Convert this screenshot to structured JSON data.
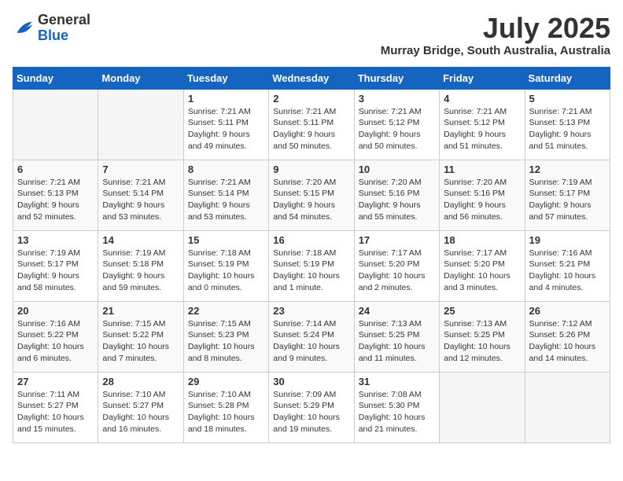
{
  "header": {
    "logo_line1": "General",
    "logo_line2": "Blue",
    "month_year": "July 2025",
    "location": "Murray Bridge, South Australia, Australia"
  },
  "weekdays": [
    "Sunday",
    "Monday",
    "Tuesday",
    "Wednesday",
    "Thursday",
    "Friday",
    "Saturday"
  ],
  "weeks": [
    [
      {
        "day": "",
        "empty": true
      },
      {
        "day": "",
        "empty": true
      },
      {
        "day": "1",
        "sunrise": "Sunrise: 7:21 AM",
        "sunset": "Sunset: 5:11 PM",
        "daylight": "Daylight: 9 hours and 49 minutes."
      },
      {
        "day": "2",
        "sunrise": "Sunrise: 7:21 AM",
        "sunset": "Sunset: 5:11 PM",
        "daylight": "Daylight: 9 hours and 50 minutes."
      },
      {
        "day": "3",
        "sunrise": "Sunrise: 7:21 AM",
        "sunset": "Sunset: 5:12 PM",
        "daylight": "Daylight: 9 hours and 50 minutes."
      },
      {
        "day": "4",
        "sunrise": "Sunrise: 7:21 AM",
        "sunset": "Sunset: 5:12 PM",
        "daylight": "Daylight: 9 hours and 51 minutes."
      },
      {
        "day": "5",
        "sunrise": "Sunrise: 7:21 AM",
        "sunset": "Sunset: 5:13 PM",
        "daylight": "Daylight: 9 hours and 51 minutes."
      }
    ],
    [
      {
        "day": "6",
        "sunrise": "Sunrise: 7:21 AM",
        "sunset": "Sunset: 5:13 PM",
        "daylight": "Daylight: 9 hours and 52 minutes."
      },
      {
        "day": "7",
        "sunrise": "Sunrise: 7:21 AM",
        "sunset": "Sunset: 5:14 PM",
        "daylight": "Daylight: 9 hours and 53 minutes."
      },
      {
        "day": "8",
        "sunrise": "Sunrise: 7:21 AM",
        "sunset": "Sunset: 5:14 PM",
        "daylight": "Daylight: 9 hours and 53 minutes."
      },
      {
        "day": "9",
        "sunrise": "Sunrise: 7:20 AM",
        "sunset": "Sunset: 5:15 PM",
        "daylight": "Daylight: 9 hours and 54 minutes."
      },
      {
        "day": "10",
        "sunrise": "Sunrise: 7:20 AM",
        "sunset": "Sunset: 5:16 PM",
        "daylight": "Daylight: 9 hours and 55 minutes."
      },
      {
        "day": "11",
        "sunrise": "Sunrise: 7:20 AM",
        "sunset": "Sunset: 5:16 PM",
        "daylight": "Daylight: 9 hours and 56 minutes."
      },
      {
        "day": "12",
        "sunrise": "Sunrise: 7:19 AM",
        "sunset": "Sunset: 5:17 PM",
        "daylight": "Daylight: 9 hours and 57 minutes."
      }
    ],
    [
      {
        "day": "13",
        "sunrise": "Sunrise: 7:19 AM",
        "sunset": "Sunset: 5:17 PM",
        "daylight": "Daylight: 9 hours and 58 minutes."
      },
      {
        "day": "14",
        "sunrise": "Sunrise: 7:19 AM",
        "sunset": "Sunset: 5:18 PM",
        "daylight": "Daylight: 9 hours and 59 minutes."
      },
      {
        "day": "15",
        "sunrise": "Sunrise: 7:18 AM",
        "sunset": "Sunset: 5:19 PM",
        "daylight": "Daylight: 10 hours and 0 minutes."
      },
      {
        "day": "16",
        "sunrise": "Sunrise: 7:18 AM",
        "sunset": "Sunset: 5:19 PM",
        "daylight": "Daylight: 10 hours and 1 minute."
      },
      {
        "day": "17",
        "sunrise": "Sunrise: 7:17 AM",
        "sunset": "Sunset: 5:20 PM",
        "daylight": "Daylight: 10 hours and 2 minutes."
      },
      {
        "day": "18",
        "sunrise": "Sunrise: 7:17 AM",
        "sunset": "Sunset: 5:20 PM",
        "daylight": "Daylight: 10 hours and 3 minutes."
      },
      {
        "day": "19",
        "sunrise": "Sunrise: 7:16 AM",
        "sunset": "Sunset: 5:21 PM",
        "daylight": "Daylight: 10 hours and 4 minutes."
      }
    ],
    [
      {
        "day": "20",
        "sunrise": "Sunrise: 7:16 AM",
        "sunset": "Sunset: 5:22 PM",
        "daylight": "Daylight: 10 hours and 6 minutes."
      },
      {
        "day": "21",
        "sunrise": "Sunrise: 7:15 AM",
        "sunset": "Sunset: 5:22 PM",
        "daylight": "Daylight: 10 hours and 7 minutes."
      },
      {
        "day": "22",
        "sunrise": "Sunrise: 7:15 AM",
        "sunset": "Sunset: 5:23 PM",
        "daylight": "Daylight: 10 hours and 8 minutes."
      },
      {
        "day": "23",
        "sunrise": "Sunrise: 7:14 AM",
        "sunset": "Sunset: 5:24 PM",
        "daylight": "Daylight: 10 hours and 9 minutes."
      },
      {
        "day": "24",
        "sunrise": "Sunrise: 7:13 AM",
        "sunset": "Sunset: 5:25 PM",
        "daylight": "Daylight: 10 hours and 11 minutes."
      },
      {
        "day": "25",
        "sunrise": "Sunrise: 7:13 AM",
        "sunset": "Sunset: 5:25 PM",
        "daylight": "Daylight: 10 hours and 12 minutes."
      },
      {
        "day": "26",
        "sunrise": "Sunrise: 7:12 AM",
        "sunset": "Sunset: 5:26 PM",
        "daylight": "Daylight: 10 hours and 14 minutes."
      }
    ],
    [
      {
        "day": "27",
        "sunrise": "Sunrise: 7:11 AM",
        "sunset": "Sunset: 5:27 PM",
        "daylight": "Daylight: 10 hours and 15 minutes."
      },
      {
        "day": "28",
        "sunrise": "Sunrise: 7:10 AM",
        "sunset": "Sunset: 5:27 PM",
        "daylight": "Daylight: 10 hours and 16 minutes."
      },
      {
        "day": "29",
        "sunrise": "Sunrise: 7:10 AM",
        "sunset": "Sunset: 5:28 PM",
        "daylight": "Daylight: 10 hours and 18 minutes."
      },
      {
        "day": "30",
        "sunrise": "Sunrise: 7:09 AM",
        "sunset": "Sunset: 5:29 PM",
        "daylight": "Daylight: 10 hours and 19 minutes."
      },
      {
        "day": "31",
        "sunrise": "Sunrise: 7:08 AM",
        "sunset": "Sunset: 5:30 PM",
        "daylight": "Daylight: 10 hours and 21 minutes."
      },
      {
        "day": "",
        "empty": true
      },
      {
        "day": "",
        "empty": true
      }
    ]
  ]
}
